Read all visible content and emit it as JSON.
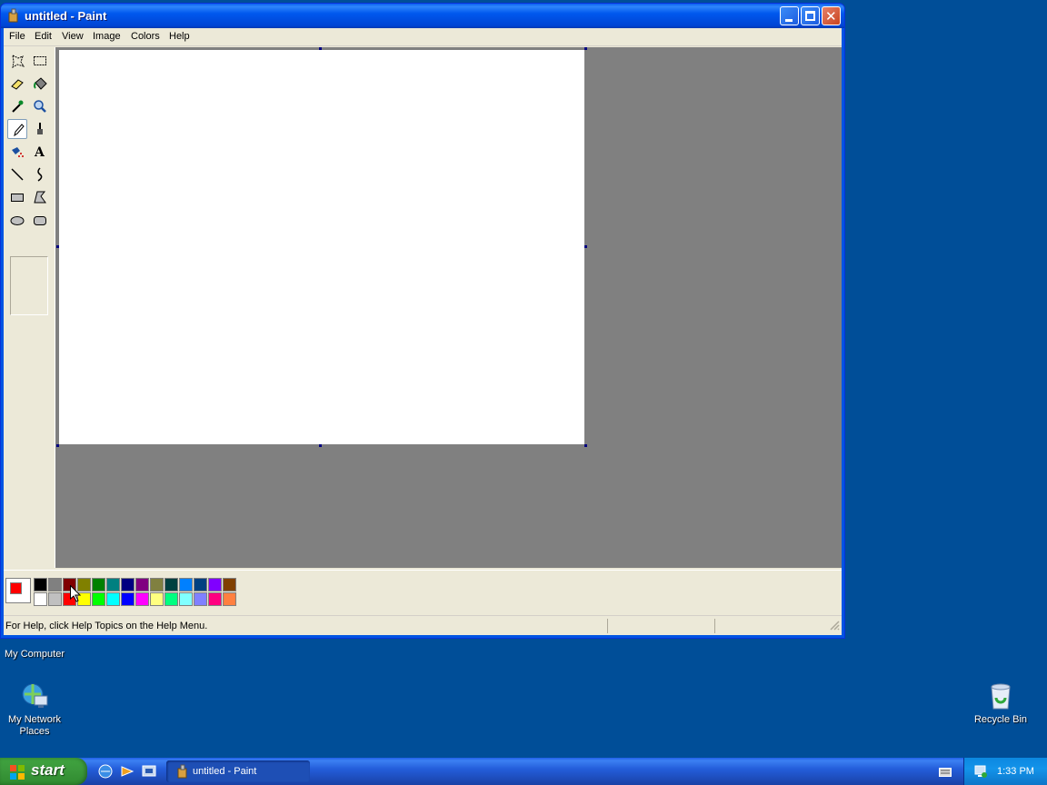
{
  "desktop": {
    "icons": [
      {
        "label": "My Computer",
        "icon": "my-computer-icon"
      },
      {
        "label": "My Network Places",
        "icon": "network-places-icon"
      },
      {
        "label": "Recycle Bin",
        "icon": "recycle-bin-icon"
      }
    ]
  },
  "window": {
    "title": "untitled - Paint",
    "controls": {
      "minimize": "minimize-icon",
      "maximize": "maximize-icon",
      "close": "close-icon"
    }
  },
  "menu": [
    "File",
    "Edit",
    "View",
    "Image",
    "Colors",
    "Help"
  ],
  "tools": [
    {
      "name": "free-form-select",
      "selected": false
    },
    {
      "name": "rect-select",
      "selected": false
    },
    {
      "name": "eraser",
      "selected": false
    },
    {
      "name": "fill",
      "selected": false
    },
    {
      "name": "pick-color",
      "selected": false
    },
    {
      "name": "magnifier",
      "selected": false
    },
    {
      "name": "pencil",
      "selected": true
    },
    {
      "name": "brush",
      "selected": false
    },
    {
      "name": "airbrush",
      "selected": false
    },
    {
      "name": "text",
      "selected": false
    },
    {
      "name": "line",
      "selected": false
    },
    {
      "name": "curve",
      "selected": false
    },
    {
      "name": "rectangle",
      "selected": false
    },
    {
      "name": "polygon",
      "selected": false
    },
    {
      "name": "ellipse",
      "selected": false
    },
    {
      "name": "rounded-rectangle",
      "selected": false
    }
  ],
  "colors": {
    "foreground": "#ff0000",
    "background": "#ffffff",
    "palette_top": [
      "#000000",
      "#808080",
      "#800000",
      "#808000",
      "#008000",
      "#008080",
      "#000080",
      "#800080",
      "#808040",
      "#004040",
      "#0080ff",
      "#004080",
      "#8000ff",
      "#804000"
    ],
    "palette_bottom": [
      "#ffffff",
      "#c0c0c0",
      "#ff0000",
      "#ffff00",
      "#00ff00",
      "#00ffff",
      "#0000ff",
      "#ff00ff",
      "#ffff80",
      "#00ff80",
      "#80ffff",
      "#8080ff",
      "#ff0080",
      "#ff8040"
    ]
  },
  "status": {
    "help_text": "For Help, click Help Topics on the Help Menu."
  },
  "taskbar": {
    "start_label": "start",
    "task_label": "untitled - Paint",
    "clock": "1:33 PM"
  }
}
